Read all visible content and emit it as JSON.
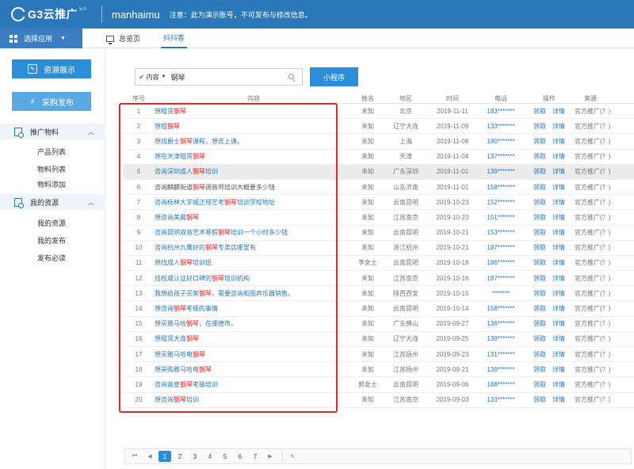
{
  "header": {
    "logo_text": "G3云推广",
    "logo_version": "5.0",
    "username": "manhaimu",
    "notice": "注意：此为演示账号，不可发布与修改信息。"
  },
  "nav": {
    "app_select": "选择应用",
    "tab_home": "总览页",
    "tab_active": "抖抖客"
  },
  "sidebar": {
    "btn_resource": "资源展示",
    "btn_buy": "采购发布",
    "section1": "推广物料",
    "section1_items": [
      "产品列表",
      "物料列表",
      "物料添加"
    ],
    "section2": "我的资源",
    "section2_items": [
      "我的资源",
      "我的发布",
      "发布必读"
    ]
  },
  "search": {
    "type": "内容",
    "value": "钢琴",
    "button": "小程序"
  },
  "table": {
    "headers": [
      "序号",
      "内容",
      "姓名",
      "地区",
      "时间",
      "电话",
      "操作",
      "来源"
    ],
    "op_claim": "领取",
    "op_detail": "详情",
    "rows": [
      {
        "no": "1",
        "pre": "想租赁",
        "kw": "钢琴",
        "post": "",
        "name": "未知",
        "region": "北京",
        "time": "2019-11-11",
        "phone": "183*******",
        "src": "官方推广(？)"
      },
      {
        "no": "2",
        "pre": "想租",
        "kw": "钢琴",
        "post": "",
        "name": "未知",
        "region": "辽宁大连",
        "time": "2019-11-09",
        "phone": "133*******",
        "src": "官方推广(？)"
      },
      {
        "no": "3",
        "pre": "想找爵士",
        "kw": "钢琴",
        "post": "课程，想去上课。",
        "name": "未知",
        "region": "上海",
        "time": "2019-11-08",
        "phone": "180*******",
        "src": "官方推广(？)"
      },
      {
        "no": "4",
        "pre": "想在天津租赁",
        "kw": "钢琴",
        "post": "",
        "name": "未知",
        "region": "天津",
        "time": "2019-11-04",
        "phone": "137*******",
        "src": "官方推广(？)"
      },
      {
        "no": "5",
        "pre": "咨询深圳成人",
        "kw": "钢琴",
        "post": "培训",
        "name": "未知",
        "region": "广东深圳",
        "time": "2019-11-01",
        "phone": "139*******",
        "src": "官方推广(？)"
      },
      {
        "no": "6",
        "pre": "咨询麒麟街道",
        "kw": "钢琴",
        "post": "调音师培训大概要多少钱",
        "name": "未知",
        "region": "山东济南",
        "time": "2019-11-01",
        "phone": "158*******",
        "src": "官方推广(？)",
        "dark": true
      },
      {
        "no": "7",
        "pre": "咨询杨林大学城正规艺考",
        "kw": "钢琴",
        "post": "培训学校地址",
        "name": "未知",
        "region": "云南昆明",
        "time": "2019-10-23",
        "phone": "152*******",
        "src": "官方推广(？)"
      },
      {
        "no": "8",
        "pre": "想咨询美晨",
        "kw": "钢琴",
        "post": "",
        "name": "未知",
        "region": "江苏南京",
        "time": "2019-10-23",
        "phone": "151*******",
        "src": "官方推广(？)"
      },
      {
        "no": "9",
        "pre": "咨询昆明双音艺术寒假",
        "kw": "钢琴",
        "post": "培训一个小时多少钱",
        "name": "未知",
        "region": "云南昆明",
        "time": "2019-10-21",
        "phone": "153*******",
        "src": "官方推广(？)"
      },
      {
        "no": "10",
        "pre": "咨询杭州九鹰好的",
        "kw": "钢琴",
        "post": "专卖店哪里有",
        "name": "未知",
        "region": "浙江杭州",
        "time": "2019-10-21",
        "phone": "187*******",
        "src": "官方推广(？)"
      },
      {
        "no": "11",
        "pre": "想找成人",
        "kw": "钢琴",
        "post": "培训班",
        "name": "李女士",
        "region": "云南昆明",
        "time": "2019-10-18",
        "phone": "186*******",
        "src": "官方推广(？)"
      },
      {
        "no": "12",
        "pre": "找权威认证好口碑的",
        "kw": "钢琴",
        "post": "培训机构",
        "name": "未知",
        "region": "江苏南京",
        "time": "2019-10-16",
        "phone": "187*******",
        "src": "官方推广(？)"
      },
      {
        "no": "13",
        "pre": "我想给孩子买架",
        "kw": "钢琴",
        "post": "，需要咨询和图声乐器销售。",
        "name": "未知",
        "region": "陕西西安",
        "time": "2019-10-15",
        "phone": "*******",
        "src": "官方推广(？)"
      },
      {
        "no": "14",
        "pre": "想咨询",
        "kw": "钢琴",
        "post": "考级的事情",
        "name": "未知",
        "region": "云南昆明",
        "time": "2019-10-14",
        "phone": "158*******",
        "src": "官方推广(？)"
      },
      {
        "no": "15",
        "pre": "想买雅马哈",
        "kw": "钢琴",
        "post": "，在顺德市。",
        "name": "未知",
        "region": "广东佛山",
        "time": "2019-09-27",
        "phone": "136*******",
        "src": "官方推广(？)"
      },
      {
        "no": "16",
        "pre": "想租赁大连",
        "kw": "钢琴",
        "post": "",
        "name": "未知",
        "region": "辽宁大连",
        "time": "2019-09-25",
        "phone": "139*******",
        "src": "官方推广(？)"
      },
      {
        "no": "17",
        "pre": "想买雅马哈电",
        "kw": "钢琴",
        "post": "",
        "name": "未知",
        "region": "江苏扬州",
        "time": "2019-09-23",
        "phone": "131*******",
        "src": "官方推广(？)"
      },
      {
        "no": "18",
        "pre": "想采购雅马哈电",
        "kw": "钢琴",
        "post": "",
        "name": "未知",
        "region": "江苏扬州",
        "time": "2019-09-21",
        "phone": "139*******",
        "src": "官方推广(？)"
      },
      {
        "no": "19",
        "pre": "咨询英皇",
        "kw": "钢琴",
        "post": "考级培训",
        "name": "郭女士",
        "region": "云南昆明",
        "time": "2019-09-06",
        "phone": "188*******",
        "src": "官方推广(？)"
      },
      {
        "no": "20",
        "pre": "想咨询",
        "kw": "钢琴",
        "post": "培训",
        "name": "未知",
        "region": "江苏南京",
        "time": "2019-09-03",
        "phone": "133*******",
        "src": "官方推广(？)"
      }
    ]
  },
  "pager": {
    "pages": [
      "1",
      "2",
      "3",
      "4",
      "5",
      "6",
      "7"
    ],
    "active": "1"
  },
  "colors": {
    "primary": "#2a78b9",
    "keyword": "#e02020",
    "frame": "#e02828"
  }
}
